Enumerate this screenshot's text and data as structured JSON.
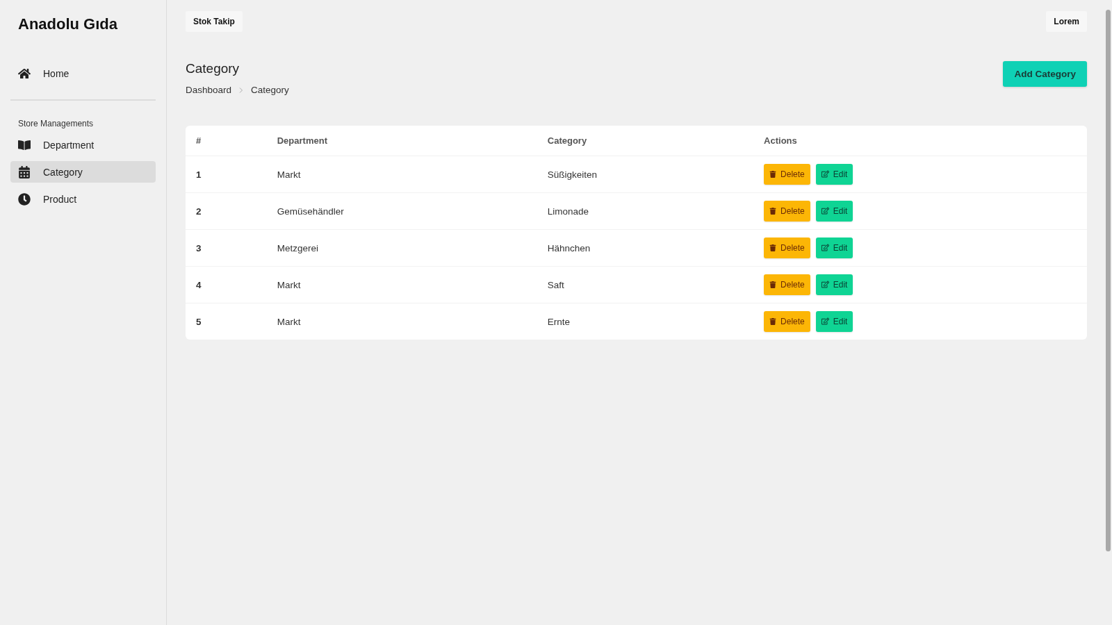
{
  "brand": "Anadolu Gıda",
  "sidebar": {
    "top_items": [
      {
        "label": "Home",
        "selected": false
      }
    ],
    "section_title": "Store Managements",
    "items": [
      {
        "label": "Department",
        "selected": false
      },
      {
        "label": "Category",
        "selected": true
      },
      {
        "label": "Product",
        "selected": false
      }
    ]
  },
  "topbar": {
    "app_button": "Stok Takip",
    "user_button": "Lorem"
  },
  "page": {
    "title": "Category",
    "breadcrumb": [
      "Dashboard",
      "Category"
    ],
    "add_button": "Add Category"
  },
  "table": {
    "columns": [
      "#",
      "Department",
      "Category",
      "Actions"
    ],
    "rows": [
      {
        "index": "1",
        "department": "Markt",
        "category": "Süßigkeiten",
        "delete_label": "Delete",
        "edit_label": "Edit"
      },
      {
        "index": "2",
        "department": "Gemüsehändler",
        "category": "Limonade",
        "delete_label": "Delete",
        "edit_label": "Edit"
      },
      {
        "index": "3",
        "department": "Metzgerei",
        "category": "Hähnchen",
        "delete_label": "Delete",
        "edit_label": "Edit"
      },
      {
        "index": "4",
        "department": "Markt",
        "category": "Saft",
        "delete_label": "Delete",
        "edit_label": "Edit"
      },
      {
        "index": "5",
        "department": "Markt",
        "category": "Ernte",
        "delete_label": "Delete",
        "edit_label": "Edit"
      }
    ]
  }
}
